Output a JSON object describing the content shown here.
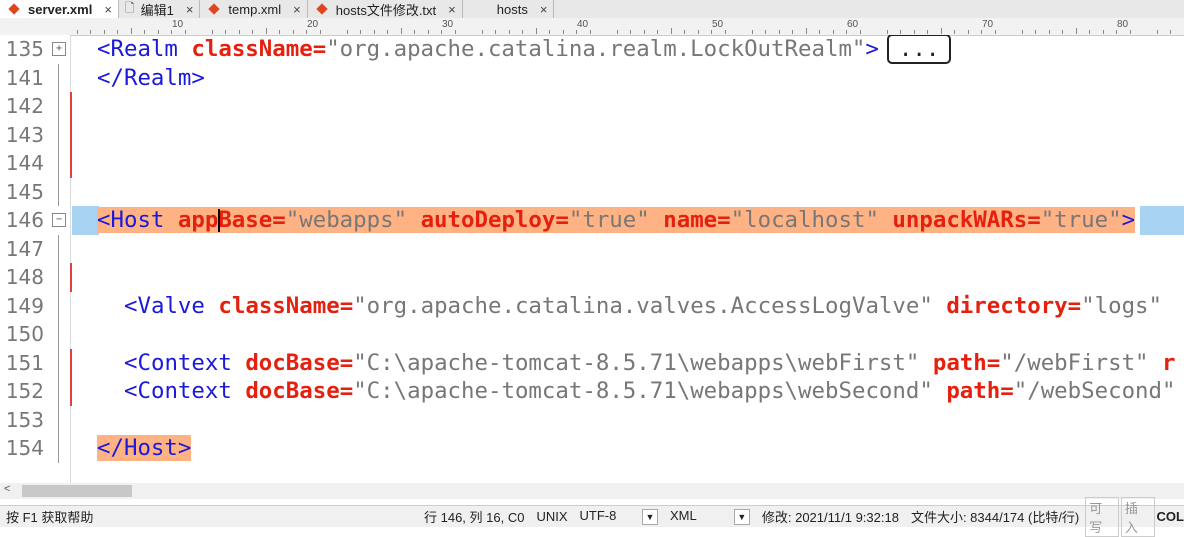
{
  "tabs": [
    {
      "label": "server.xml",
      "icon": "xml-diamond-icon",
      "active": true
    },
    {
      "label": "编辑1",
      "icon": "document-icon"
    },
    {
      "label": "temp.xml",
      "icon": "xml-diamond-icon"
    },
    {
      "label": "hosts文件修改.txt",
      "icon": "xml-diamond-icon"
    },
    {
      "label": "hosts",
      "icon": ""
    }
  ],
  "close_glyph": "×",
  "ruler": [
    "10",
    "20",
    "30",
    "40",
    "50",
    "60",
    "70",
    "80"
  ],
  "lines": [
    {
      "n": "135",
      "fold": "+",
      "indent": 2,
      "tokens": [
        [
          "tag",
          "<Realm "
        ],
        [
          "attr",
          "className"
        ],
        [
          "eq",
          "="
        ],
        [
          "val",
          "\"org.apache.catalina.realm.LockOutRealm\""
        ],
        [
          "tag",
          ">"
        ]
      ],
      "ellipsis": "..."
    },
    {
      "n": "141",
      "indent": 2,
      "tokens": [
        [
          "tag",
          "</Realm>"
        ]
      ]
    },
    {
      "n": "142",
      "chg": true,
      "tokens": []
    },
    {
      "n": "143",
      "chg": true,
      "tokens": []
    },
    {
      "n": "144",
      "chg": true,
      "tokens": []
    },
    {
      "n": "145",
      "tokens": []
    },
    {
      "n": "146",
      "fold": "−",
      "indent": 2,
      "current": true,
      "tokens": [
        [
          "tag",
          "<Host "
        ],
        [
          "attr",
          "appBase"
        ],
        [
          "eq",
          "="
        ],
        [
          "val",
          "\"webapps\" "
        ],
        [
          "attr",
          "autoDeploy"
        ],
        [
          "eq",
          "="
        ],
        [
          "val",
          "\"true\" "
        ],
        [
          "attr",
          "name"
        ],
        [
          "eq",
          "="
        ],
        [
          "val",
          "\"localhost\" "
        ],
        [
          "attr",
          "unpackWARs"
        ],
        [
          "eq",
          "="
        ],
        [
          "val",
          "\"true\""
        ],
        [
          "tag",
          ">"
        ]
      ]
    },
    {
      "n": "147",
      "tokens": []
    },
    {
      "n": "148",
      "chg": true,
      "tokens": []
    },
    {
      "n": "149",
      "indent": 4,
      "tokens": [
        [
          "tag",
          "<Valve "
        ],
        [
          "attr",
          "className"
        ],
        [
          "eq",
          "="
        ],
        [
          "val",
          "\"org.apache.catalina.valves.AccessLogValve\" "
        ],
        [
          "attr",
          "directory"
        ],
        [
          "eq",
          "="
        ],
        [
          "val",
          "\"logs\""
        ]
      ]
    },
    {
      "n": "150",
      "tokens": []
    },
    {
      "n": "151",
      "chg": true,
      "indent": 4,
      "tokens": [
        [
          "tag",
          "<Context "
        ],
        [
          "attr",
          "docBase"
        ],
        [
          "eq",
          "="
        ],
        [
          "val",
          "\"C:\\apache-tomcat-8.5.71\\webapps\\webFirst\" "
        ],
        [
          "attr",
          "path"
        ],
        [
          "eq",
          "="
        ],
        [
          "val",
          "\"/webFirst\" "
        ],
        [
          "attr",
          "r"
        ]
      ]
    },
    {
      "n": "152",
      "chg": true,
      "indent": 4,
      "tokens": [
        [
          "tag",
          "<Context "
        ],
        [
          "attr",
          "docBase"
        ],
        [
          "eq",
          "="
        ],
        [
          "val",
          "\"C:\\apache-tomcat-8.5.71\\webapps\\webSecond\" "
        ],
        [
          "attr",
          "path"
        ],
        [
          "eq",
          "="
        ],
        [
          "val",
          "\"/webSecond\""
        ]
      ]
    },
    {
      "n": "153",
      "tokens": []
    },
    {
      "n": "154",
      "indent": 2,
      "match": true,
      "tokens": [
        [
          "tag",
          "</Host>"
        ]
      ]
    }
  ],
  "status": {
    "help": "按 F1 获取帮助",
    "position": "行 146, 列 16, C0",
    "line_ending": "UNIX",
    "encoding": "UTF-8",
    "language": "XML",
    "modified": "修改:  2021/11/1 9:32:18",
    "filesize": "文件大小:  8344/174  (比特/行)",
    "writable": "可写",
    "insert": "插入",
    "col": "COL"
  }
}
